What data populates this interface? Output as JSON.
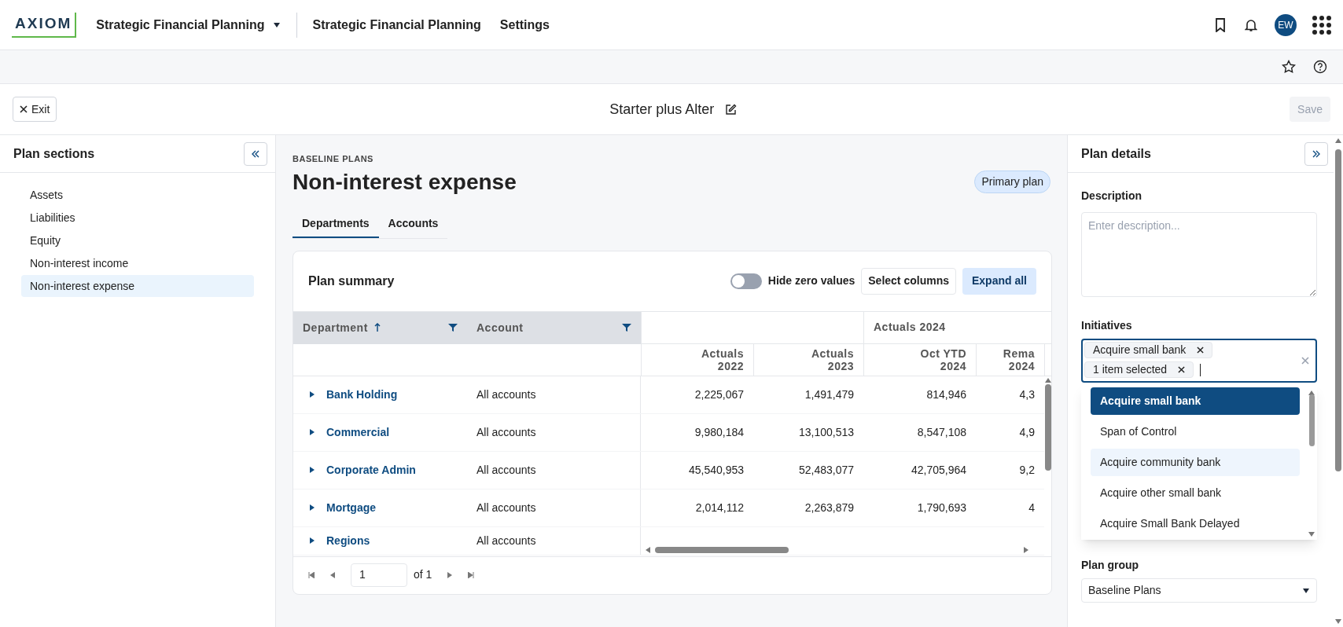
{
  "header": {
    "logo": "AXIOM",
    "app_menu": "Strategic Financial Planning",
    "nav": [
      "Strategic Financial Planning",
      "Settings"
    ],
    "avatar": "EW"
  },
  "toolbar": {
    "exit": "Exit",
    "title": "Starter plus Alter",
    "save": {
      "label": "Save",
      "disabled": true
    }
  },
  "plan_sections": {
    "title": "Plan sections",
    "items": [
      {
        "label": "Assets",
        "selected": false
      },
      {
        "label": "Liabilities",
        "selected": false
      },
      {
        "label": "Equity",
        "selected": false
      },
      {
        "label": "Non-interest income",
        "selected": false
      },
      {
        "label": "Non-interest expense",
        "selected": true
      }
    ]
  },
  "main": {
    "eyebrow": "BASELINE PLANS",
    "title": "Non-interest expense",
    "badge": "Primary plan",
    "tabs": [
      {
        "label": "Departments",
        "selected": true
      },
      {
        "label": "Accounts",
        "selected": false
      }
    ],
    "card": {
      "title": "Plan summary",
      "toggle": {
        "label": "Hide zero values",
        "on": false
      },
      "select_columns": "Select columns",
      "expand_all": "Expand all",
      "columns": [
        {
          "label": "Department",
          "sorted": true
        },
        {
          "label": "Account",
          "sorted": false
        }
      ],
      "group_header": "Actuals 2024",
      "value_columns": [
        {
          "lines": [
            "Actuals",
            "2022"
          ]
        },
        {
          "lines": [
            "Actuals",
            "2023"
          ]
        },
        {
          "lines": [
            "Oct YTD",
            "2024"
          ]
        },
        {
          "lines": [
            "Rema",
            "2024"
          ]
        }
      ],
      "rows": [
        {
          "department": "Bank Holding",
          "account": "All accounts",
          "values": [
            "2,225,067",
            "1,491,479",
            "814,946",
            "4,3"
          ]
        },
        {
          "department": "Commercial",
          "account": "All accounts",
          "values": [
            "9,980,184",
            "13,100,513",
            "8,547,108",
            "4,9"
          ]
        },
        {
          "department": "Corporate Admin",
          "account": "All accounts",
          "values": [
            "45,540,953",
            "52,483,077",
            "42,705,964",
            "9,2"
          ]
        },
        {
          "department": "Mortgage",
          "account": "All accounts",
          "values": [
            "2,014,112",
            "2,263,879",
            "1,790,693",
            "4"
          ]
        },
        {
          "department": "Regions",
          "account": "All accounts"
        }
      ],
      "pager": {
        "page": "1",
        "of": "of 1"
      }
    }
  },
  "plan_details": {
    "title": "Plan details",
    "description": {
      "label": "Description",
      "placeholder": "Enter description..."
    },
    "initiatives": {
      "label": "Initiatives",
      "chips": [
        "Acquire small bank",
        "1 item selected"
      ],
      "options": [
        {
          "label": "Acquire small bank",
          "selected": true,
          "hovered": false
        },
        {
          "label": "Span of Control",
          "selected": false,
          "hovered": false
        },
        {
          "label": "Acquire community bank",
          "selected": false,
          "hovered": true
        },
        {
          "label": "Acquire other small bank",
          "selected": false,
          "hovered": false
        },
        {
          "label": "Acquire Small Bank Delayed",
          "selected": false,
          "hovered": false
        }
      ]
    },
    "plan_group": {
      "label": "Plan group",
      "value": "Baseline Plans"
    }
  }
}
